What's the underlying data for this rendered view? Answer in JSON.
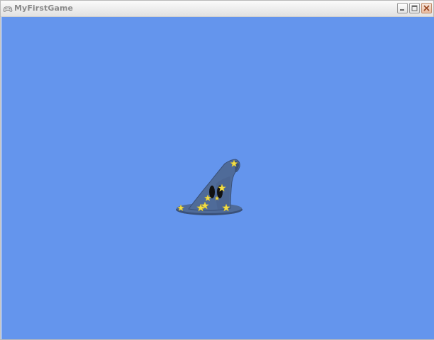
{
  "window": {
    "title": "MyFirstGame",
    "icon": "gamepad-icon",
    "controls": [
      "minimize-icon",
      "maximize-icon",
      "close-icon"
    ]
  },
  "game": {
    "background_color": "#6495ed",
    "sprite": "wizard-hat",
    "sprite_colors": {
      "hat_body": "#4f6b99",
      "hat_shadow": "#3a5179",
      "stars": "#f3de45",
      "eyes": "#111111"
    }
  }
}
